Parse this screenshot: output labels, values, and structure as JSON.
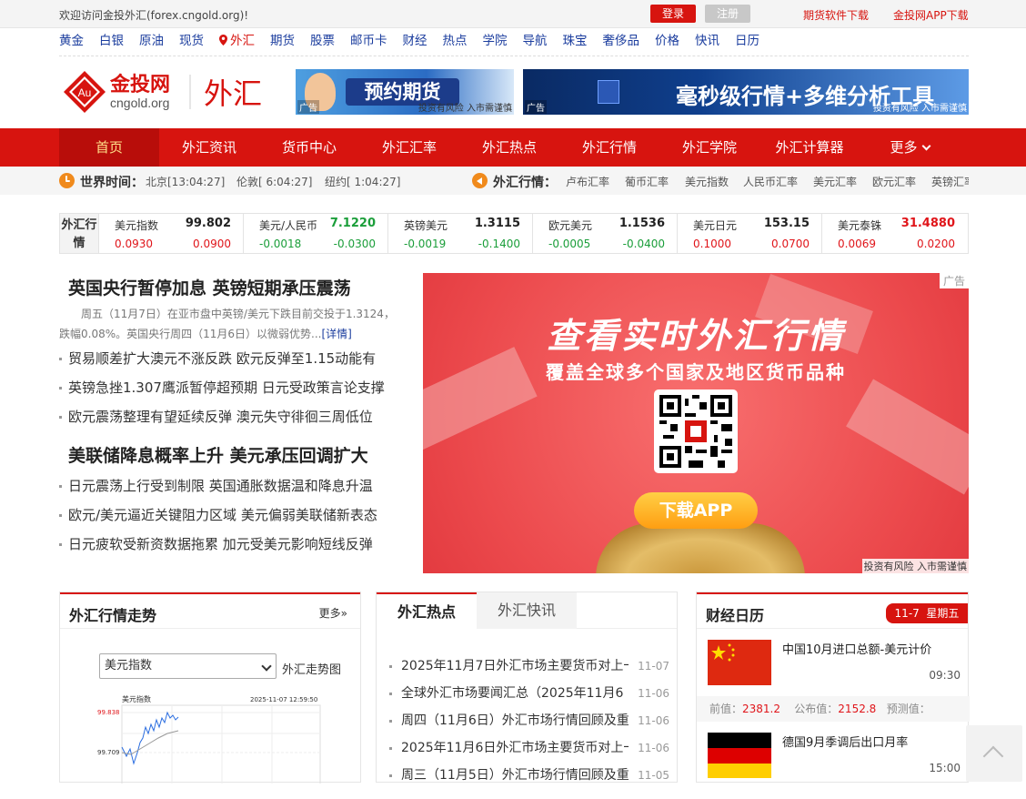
{
  "topbar": {
    "welcome": "欢迎访问金投外汇(forex.cngold.org)!",
    "login": "登录",
    "register": "注册",
    "link1": "期货软件下载",
    "link2": "金投网APP下载"
  },
  "category_nav": [
    "黄金",
    "白银",
    "原油",
    "现货",
    "外汇",
    "期货",
    "股票",
    "邮币卡",
    "财经",
    "热点",
    "学院",
    "导航",
    "珠宝",
    "奢侈品",
    "价格",
    "快讯",
    "日历"
  ],
  "category_active": "外汇",
  "logo": {
    "brand": "金投网",
    "domain": "cngold.org",
    "badge": "Au",
    "channel": "外汇"
  },
  "ads": {
    "ad1_text": "预约期货",
    "ad1_tag": "广告",
    "ad1_risk": "投资有风险 入市需谨慎",
    "ad2_text": "毫秒级行情+多维分析工具",
    "ad2_tag": "广告",
    "ad2_risk": "投资有风险 入市需谨慎"
  },
  "main_nav": [
    "首页",
    "外汇资讯",
    "货币中心",
    "外汇汇率",
    "外汇热点",
    "外汇行情",
    "外汇学院",
    "外汇计算器",
    "更多"
  ],
  "main_nav_active": "首页",
  "time_bar": {
    "world_time_label": "世界时间：",
    "beijing": "北京[13:04:27]",
    "london": "伦敦[ 6:04:27]",
    "newyork": "纽约[ 1:04:27]",
    "fx_label": "外汇行情：",
    "fx_links": [
      "卢布汇率",
      "葡币汇率",
      "美元指数",
      "人民币汇率",
      "美元汇率",
      "欧元汇率",
      "英镑汇率"
    ]
  },
  "quotes": {
    "label": "外汇行情",
    "items": [
      {
        "name": "美元指数",
        "value": "99.802",
        "change": "0.0930",
        "pct": "0.0900",
        "color": "#e0151a",
        "vcolor": "#222"
      },
      {
        "name": "美元/人民币",
        "value": "7.1220",
        "change": "-0.0018",
        "pct": "-0.0300",
        "color": "#1b9e3a",
        "vcolor": "#1b9e3a"
      },
      {
        "name": "英镑美元",
        "value": "1.3115",
        "change": "-0.0019",
        "pct": "-0.1400",
        "color": "#1b9e3a",
        "vcolor": "#222"
      },
      {
        "name": "欧元美元",
        "value": "1.1536",
        "change": "-0.0005",
        "pct": "-0.0400",
        "color": "#1b9e3a",
        "vcolor": "#222"
      },
      {
        "name": "美元日元",
        "value": "153.15",
        "change": "0.1000",
        "pct": "0.0700",
        "color": "#e0151a",
        "vcolor": "#222"
      },
      {
        "name": "美元泰铢",
        "value": "31.4880",
        "change": "0.0069",
        "pct": "0.0200",
        "color": "#e0151a",
        "vcolor": "#e0151a"
      }
    ]
  },
  "news": {
    "headline1": "英国央行暂停加息 英镑短期承压震荡",
    "summary": "周五（11月7日）在亚市盘中英镑/美元下跌目前交投于1.3124，跌幅0.08%。英国央行周四（11月6日）以微弱优势...",
    "summary_more": "[详情]",
    "items1": [
      "贸易顺差扩大澳元不涨反跌 欧元反弹至1.15动能有",
      "英镑急挫1.307鹰派暂停超预期 日元受政策言论支撑",
      "欧元震荡整理有望延续反弹 澳元失守徘徊三周低位"
    ],
    "headline2": "美联储降息概率上升 美元承压回调扩大",
    "items2": [
      "日元震荡上行受到制限 英国通胀数据温和降息升温",
      "欧元/美元逼近关键阻力区域 美元偏弱美联储新表态",
      "日元疲软受新资数据拖累 加元受美元影响短线反弹"
    ]
  },
  "banner": {
    "title": "查看实时外汇行情",
    "subtitle": "覆盖全球多个国家及地区货币品种",
    "button": "下载APP",
    "ad_tag": "广告",
    "risk": "投资有风险 入市需谨慎"
  },
  "trend_panel": {
    "title": "外汇行情走势",
    "more": "更多»",
    "select": "美元指数",
    "select_label": "外汇走势图",
    "chart_title": "美元指数",
    "chart_time": "2025-11-07 12:59:50",
    "chart_high": "99.838",
    "chart_low": "99.709"
  },
  "hot_panel": {
    "tab_active": "外汇热点",
    "tab_other": "外汇快讯",
    "items": [
      {
        "title": "2025年11月7日外汇市场主要货币对上一",
        "date": "11-07"
      },
      {
        "title": "全球外汇市场要闻汇总（2025年11月6",
        "date": "11-06"
      },
      {
        "title": "周四（11月6日）外汇市场行情回顾及重",
        "date": "11-06"
      },
      {
        "title": "2025年11月6日外汇市场主要货币对上一",
        "date": "11-06"
      },
      {
        "title": "周三（11月5日）外汇市场行情回顾及重",
        "date": "11-05"
      }
    ]
  },
  "calendar_panel": {
    "title": "财经日历",
    "date": "11-7",
    "weekday": "星期五",
    "events": [
      {
        "title": "中国10月进口总额-美元计价",
        "time": "09:30",
        "prev_label": "前值：",
        "prev": "2381.2",
        "actual_label": "公布值：",
        "actual": "2152.8",
        "forecast_label": "预测值："
      },
      {
        "title": "德国9月季调后出口月率",
        "time": "15:00"
      }
    ]
  },
  "colors": {
    "brand_red": "#d7140f",
    "up": "#e0151a",
    "down": "#1b9e3a",
    "link": "#1b3d9e"
  }
}
